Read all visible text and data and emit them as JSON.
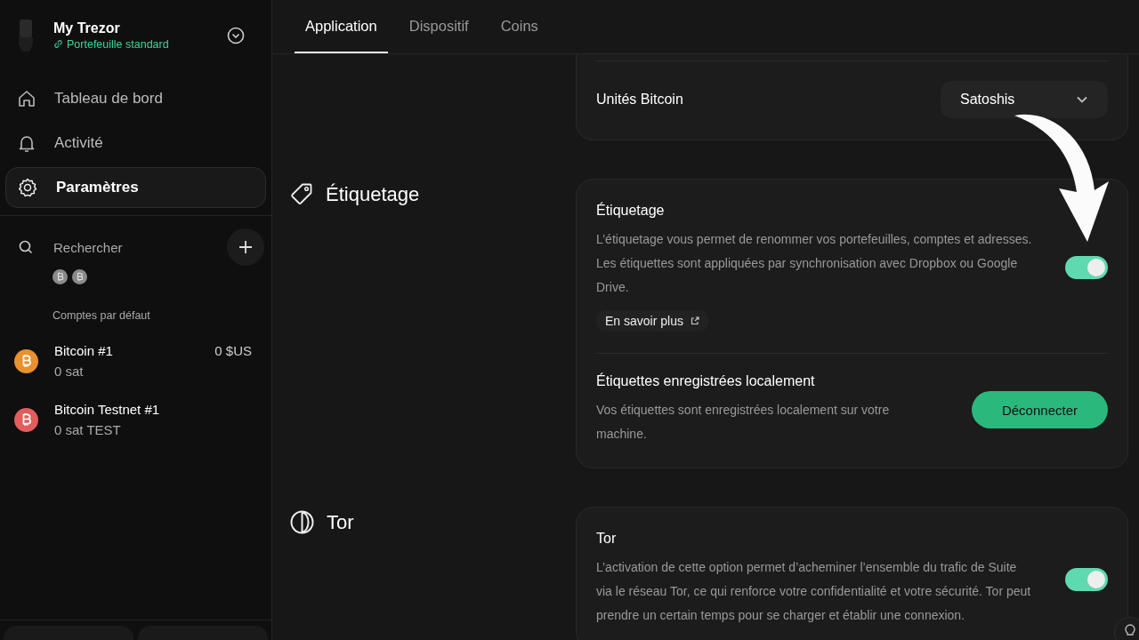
{
  "device": {
    "name": "My Trezor",
    "wallet": "Portefeuille standard"
  },
  "nav": [
    {
      "label": "Tableau de bord",
      "kind": "home",
      "selected": false
    },
    {
      "label": "Activité",
      "kind": "bell",
      "selected": false
    },
    {
      "label": "Paramètres",
      "kind": "gear",
      "selected": true
    }
  ],
  "search": {
    "placeholder": "Rechercher"
  },
  "coin_filters": [
    {
      "selected": false
    },
    {
      "selected": false
    }
  ],
  "accounts_heading": "Comptes par défaut",
  "accounts": [
    {
      "name": "Bitcoin #1",
      "balance": "0 sat",
      "fiat": "0 $US",
      "color": "#e8912d"
    },
    {
      "name": "Bitcoin Testnet #1",
      "balance": "0 sat TEST",
      "color": "#e35d5d"
    }
  ],
  "tabs": [
    {
      "label": "Application",
      "selected": true
    },
    {
      "label": "Dispositif",
      "selected": false
    },
    {
      "label": "Coins",
      "selected": false
    }
  ],
  "sections": [
    {
      "rows": [
        {
          "kind": "select",
          "title": "Unités Bitcoin",
          "value": "Satoshis"
        }
      ]
    },
    {
      "title": "Étiquetage",
      "kind": "tag",
      "rows": [
        {
          "kind": "toggle",
          "title": "Étiquetage",
          "description": "L’étiquetage vous permet de renommer vos portefeuilles, comptes et adresses. Les étiquettes sont appliquées par synchronisation avec Dropbox ou Google Drive.",
          "on": true,
          "link": "En savoir plus"
        },
        {
          "kind": "button",
          "title": "Étiquettes enregistrées localement",
          "description": "Vos étiquettes sont enregistrées localement sur votre machine.",
          "button": "Déconnecter"
        }
      ]
    },
    {
      "title": "Tor",
      "kind": "tor",
      "rows": [
        {
          "kind": "toggle",
          "title": "Tor",
          "description": "L’activation de cette option permet d’acheminer l’ensemble du trafic de Suite via le réseau Tor, ce qui renforce votre confidentialité et votre sécurité. Tor peut prendre un certain temps pour se charger et établir une connexion.",
          "on": true
        }
      ]
    }
  ]
}
